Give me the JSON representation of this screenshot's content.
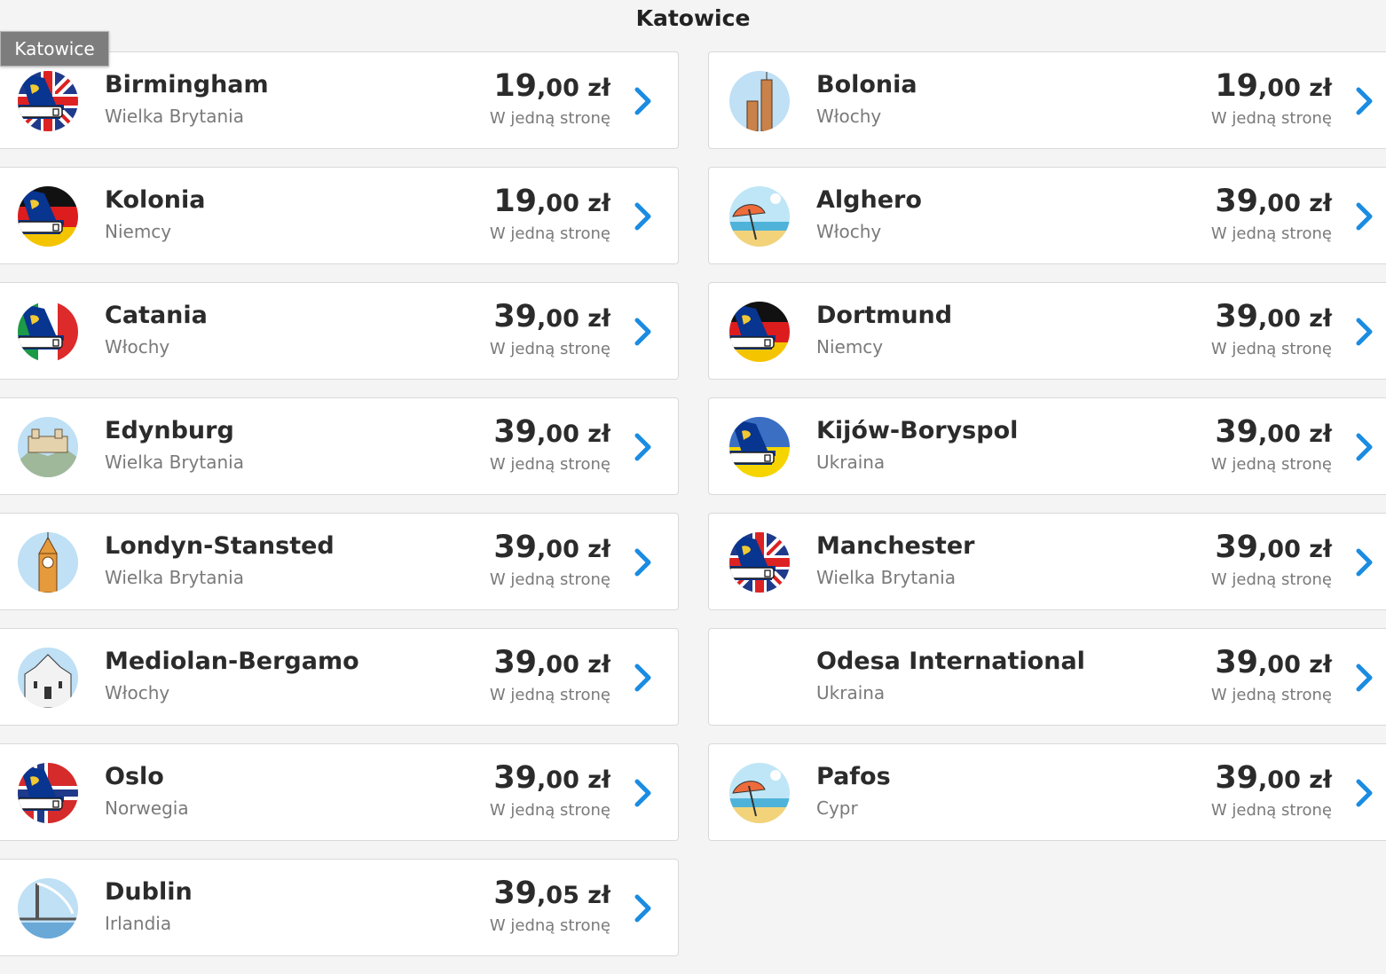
{
  "page": {
    "title": "Katowice",
    "tooltip": "Katowice",
    "fare_label": "W jedną stronę",
    "currency": "zł"
  },
  "colors": {
    "chevron": "#1a8ce2",
    "text_dark": "#2b2b2b",
    "text_muted": "#7a7a7a",
    "ryanair_blue": "#073590",
    "ryanair_yellow": "#f1c933"
  },
  "left_column": [
    {
      "city": "Birmingham",
      "country": "Wielka Brytania",
      "price_major": "19",
      "price_minor": ",00 zł",
      "icon": "ryanair-tail-uk-flag-icon"
    },
    {
      "city": "Kolonia",
      "country": "Niemcy",
      "price_major": "19",
      "price_minor": ",00 zł",
      "icon": "ryanair-tail-germany-flag-icon"
    },
    {
      "city": "Catania",
      "country": "Włochy",
      "price_major": "39",
      "price_minor": ",00 zł",
      "icon": "ryanair-tail-italy-flag-icon"
    },
    {
      "city": "Edynburg",
      "country": "Wielka Brytania",
      "price_major": "39",
      "price_minor": ",00 zł",
      "icon": "edinburgh-castle-icon"
    },
    {
      "city": "Londyn-Stansted",
      "country": "Wielka Brytania",
      "price_major": "39",
      "price_minor": ",00 zł",
      "icon": "big-ben-icon"
    },
    {
      "city": "Mediolan-Bergamo",
      "country": "Włochy",
      "price_major": "39",
      "price_minor": ",00 zł",
      "icon": "milan-cathedral-icon"
    },
    {
      "city": "Oslo",
      "country": "Norwegia",
      "price_major": "39",
      "price_minor": ",00 zł",
      "icon": "ryanair-tail-norway-flag-icon"
    },
    {
      "city": "Dublin",
      "country": "Irlandia",
      "price_major": "39",
      "price_minor": ",05 zł",
      "icon": "dublin-bridge-icon"
    }
  ],
  "right_column": [
    {
      "city": "Bolonia",
      "country": "Włochy",
      "price_major": "19",
      "price_minor": ",00 zł",
      "icon": "bologna-towers-icon"
    },
    {
      "city": "Alghero",
      "country": "Włochy",
      "price_major": "39",
      "price_minor": ",00 zł",
      "icon": "beach-umbrella-icon"
    },
    {
      "city": "Dortmund",
      "country": "Niemcy",
      "price_major": "39",
      "price_minor": ",00 zł",
      "icon": "ryanair-tail-germany-flag-icon"
    },
    {
      "city": "Kijów-Boryspol",
      "country": "Ukraina",
      "price_major": "39",
      "price_minor": ",00 zł",
      "icon": "ryanair-tail-ukraine-flag-icon"
    },
    {
      "city": "Manchester",
      "country": "Wielka Brytania",
      "price_major": "39",
      "price_minor": ",00 zł",
      "icon": "ryanair-tail-uk-flag-icon"
    },
    {
      "city": "Odesa International",
      "country": "Ukraina",
      "price_major": "39",
      "price_minor": ",00 zł",
      "icon": ""
    },
    {
      "city": "Pafos",
      "country": "Cypr",
      "price_major": "39",
      "price_minor": ",00 zł",
      "icon": "beach-umbrella-icon"
    }
  ]
}
